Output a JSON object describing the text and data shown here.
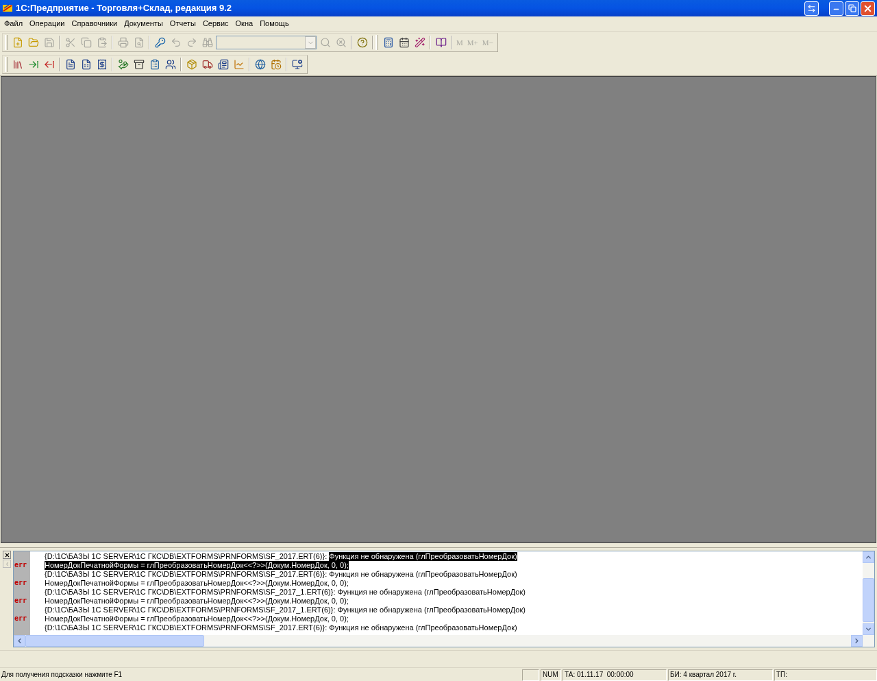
{
  "window": {
    "title": "1С:Предприятие - Торговля+Склад, редакция 9.2"
  },
  "menu": [
    "Файл",
    "Операции",
    "Справочники",
    "Документы",
    "Отчеты",
    "Сервис",
    "Окна",
    "Помощь"
  ],
  "toolbar_1": {
    "buttons": [
      {
        "disabled": false
      },
      {
        "disabled": false
      },
      {
        "disabled": true
      },
      {
        "disabled": true
      },
      {
        "disabled": true
      },
      {
        "disabled": true
      },
      {
        "disabled": true
      },
      {
        "disabled": true
      },
      {
        "disabled": false
      },
      {
        "disabled": true
      },
      {
        "disabled": true
      },
      {
        "disabled": true
      }
    ],
    "combo": {
      "disabled": true
    },
    "buttons_after": [
      {
        "disabled": true
      },
      {
        "disabled": true
      },
      {
        "disabled": false
      },
      {
        "disabled": false
      },
      {
        "disabled": false
      },
      {
        "disabled": false
      },
      {
        "disabled": false
      }
    ],
    "memory_buttons": [
      {
        "label": "M",
        "disabled": true
      },
      {
        "label": "M+",
        "disabled": true
      },
      {
        "label": "M−",
        "disabled": true
      }
    ]
  },
  "messages": [
    {
      "segments": [
        {
          "text": "{D:\\1C\\БАЗЫ 1C SERVER\\1C ГКС\\DB\\EXTFORMS\\PRNFORMS\\SF_2017.ERT(6)}: ",
          "selected": false
        },
        {
          "text": "Функция не обнаружена (глПреобразоватьНомерДок)",
          "selected": true
        }
      ]
    },
    {
      "marker": "err",
      "segments": [
        {
          "text": "НомерДокПечатнойФормы = глПреобразоватьНомерДок<<?>>(Докум.НомерДок, 0, 0);",
          "selected": true
        }
      ]
    },
    {
      "segments": [
        {
          "text": "{D:\\1C\\БАЗЫ 1C SERVER\\1C ГКС\\DB\\EXTFORMS\\PRNFORMS\\SF_2017.ERT(6)}: Функция не обнаружена (глПреобразоватьНомерДок)",
          "selected": false
        }
      ]
    },
    {
      "marker": "err",
      "segments": [
        {
          "text": "НомерДокПечатнойФормы = глПреобразоватьНомерДок<<?>>(Докум.НомерДок, 0, 0);",
          "selected": false
        }
      ]
    },
    {
      "segments": [
        {
          "text": "{D:\\1C\\БАЗЫ 1C SERVER\\1C ГКС\\DB\\EXTFORMS\\PRNFORMS\\SF_2017_1.ERT(6)}: Функция не обнаружена (глПреобразоватьНомерДок)",
          "selected": false
        }
      ]
    },
    {
      "marker": "err",
      "segments": [
        {
          "text": "НомерДокПечатнойФормы = глПреобразоватьНомерДок<<?>>(Докум.НомерДок, 0, 0);",
          "selected": false
        }
      ]
    },
    {
      "segments": [
        {
          "text": "{D:\\1C\\БАЗЫ 1C SERVER\\1C ГКС\\DB\\EXTFORMS\\PRNFORMS\\SF_2017_1.ERT(6)}: Функция не обнаружена (глПреобразоватьНомерДок)",
          "selected": false
        }
      ]
    },
    {
      "marker": "err",
      "segments": [
        {
          "text": "НомерДокПечатнойФормы = глПреобразоватьНомерДок<<?>>(Докум.НомерДок, 0, 0);",
          "selected": false
        }
      ]
    },
    {
      "segments": [
        {
          "text": "{D:\\1C\\БАЗЫ 1C SERVER\\1C ГКС\\DB\\EXTFORMS\\PRNFORMS\\SF_2017.ERT(6)}: Функция не обнаружена (глПреобразоватьНомерДок)",
          "selected": false
        }
      ]
    }
  ],
  "status_bar": {
    "hint": "Для получения подсказки нажмите F1",
    "fields": [
      "NUM",
      "ТА: 01.11.17  00:00:00",
      "БИ: 4 квартал 2017 г.",
      "ТП:"
    ]
  }
}
